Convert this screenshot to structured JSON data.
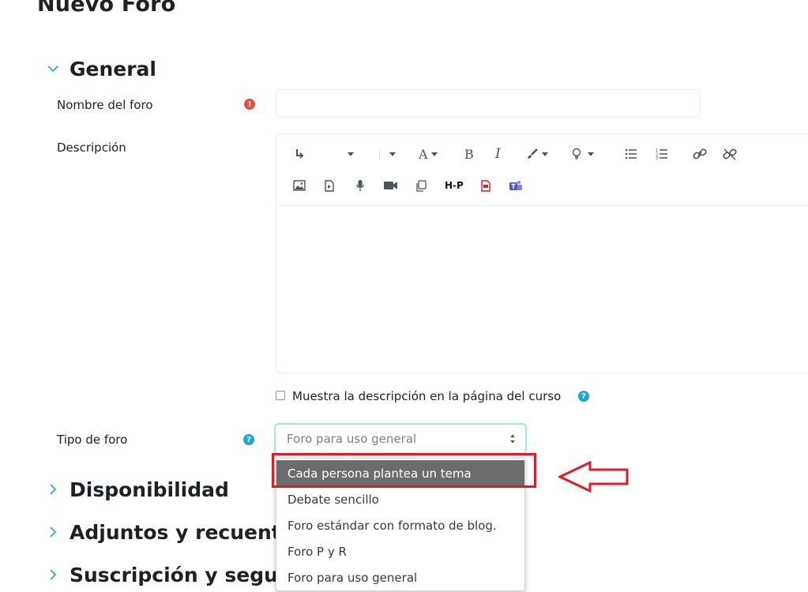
{
  "page": {
    "title": "Nuevo Foro"
  },
  "sections": {
    "general": "General",
    "disponibilidad": "Disponibilidad",
    "adjuntos": "Adjuntos y recuent",
    "suscripcion": "Suscripción y segui"
  },
  "form": {
    "nombre_label": "Nombre del foro",
    "nombre_value": "",
    "descripcion_label": "Descripción",
    "mostrar_descripcion_label": "Muestra la descripción en la página del curso",
    "mostrar_descripcion_checked": false,
    "tipo_label": "Tipo de foro",
    "tipo_value": "Foro para uso general"
  },
  "editor": {
    "toolbar_row1": [
      "undo-icon",
      "paragraph-dropdown",
      "font-size-dropdown",
      "font-color-dropdown",
      "bold-icon",
      "italic-icon",
      "highlighter-dropdown",
      "lightbulb-dropdown",
      "bullet-list-icon",
      "numbered-list-icon",
      "link-icon",
      "unlink-icon"
    ],
    "toolbar_row2": [
      "image-icon",
      "media-icon",
      "microphone-icon",
      "video-icon",
      "copy-icon",
      "h5p-icon",
      "pdf-icon",
      "teams-icon"
    ],
    "h5p_label": "H-P"
  },
  "dropdown": {
    "options": [
      "Cada persona plantea un tema",
      "Debate sencillo",
      "Foro estándar con formato de blog.",
      "Foro P y R",
      "Foro para uso general"
    ],
    "highlighted_option": "Cada persona plantea un tema"
  },
  "colors": {
    "accent": "#0f6cbf",
    "required": "#e9503d",
    "help": "#1aa8d8",
    "annotation": "#e01b24",
    "option_highlight": "#6c6c6c"
  }
}
